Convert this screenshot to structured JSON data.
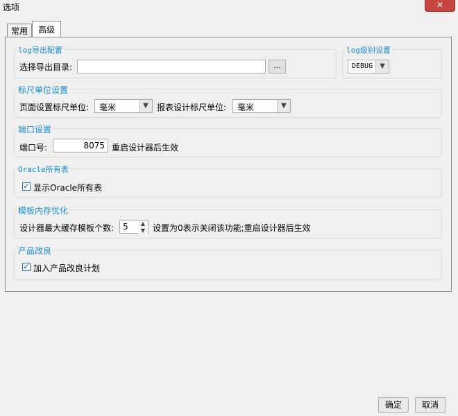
{
  "window": {
    "title": "选项",
    "close_glyph": "✕"
  },
  "tabs": [
    {
      "label": "常用",
      "active": false
    },
    {
      "label": "高级",
      "active": true
    }
  ],
  "groups": {
    "log_export": {
      "title": "log导出配置",
      "dir_label": "选择导出目录:",
      "dir_value": "",
      "browse_label": "..."
    },
    "log_level": {
      "title": "log级别设置",
      "selected": "DEBUG"
    },
    "ruler": {
      "title": "标尺单位设置",
      "page_label": "页面设置标尺单位:",
      "page_selected": "毫米",
      "report_label": "报表设计标尺单位:",
      "report_selected": "毫米"
    },
    "port": {
      "title": "端口设置",
      "label": "端口号:",
      "value": "8075",
      "hint": "重启设计器后生效"
    },
    "oracle": {
      "title": "Oracle所有表",
      "checkbox_label": "显示Oracle所有表",
      "checked": true
    },
    "template_cache": {
      "title": "模板内存优化",
      "label": "设计器最大缓存模板个数:",
      "value": "5",
      "hint": "设置为0表示关闭该功能;重启设计器后生效"
    },
    "improvement": {
      "title": "产品改良",
      "checkbox_label": "加入产品改良计划",
      "checked": true
    }
  },
  "footer": {
    "ok_label": "确定",
    "cancel_label": "取消"
  },
  "colors": {
    "group_title": "#1a8bc9",
    "close_button": "#c7463f"
  }
}
